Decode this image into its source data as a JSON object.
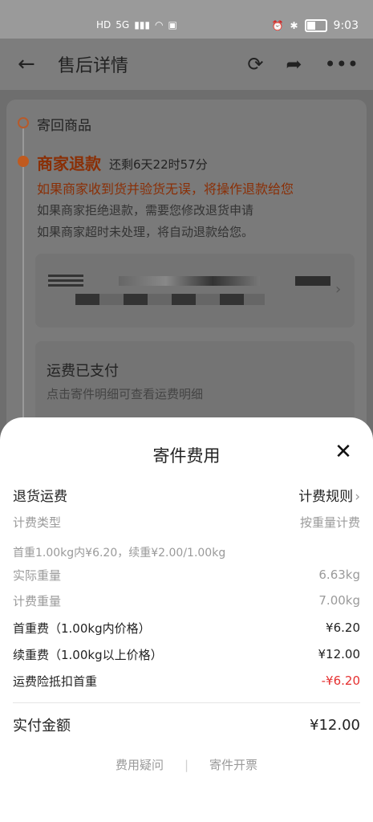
{
  "status_bar": {
    "network": "5G",
    "time": "9:03",
    "battery_level": 0.45
  },
  "nav": {
    "title": "售后详情"
  },
  "background": {
    "step1": "寄回商品",
    "step2_title": "商家退款",
    "step2_remaining": "还剩6天22时57分",
    "step2_note": "如果商家收到货并验货无误，将操作退款给您",
    "step2_line1": "如果商家拒绝退款，需要您修改退货申请",
    "step2_line2": "如果商家超时未处理，将自动退款给您。",
    "paid_title": "运费已支付",
    "paid_desc": "点击寄件明细可查看运费明细"
  },
  "sheet": {
    "title": "寄件费用",
    "return_freight_label": "退货运费",
    "rules_label": "计费规则",
    "billing_type_label": "计费类型",
    "billing_type_value": "按重量计费",
    "price_desc": "首重1.00kg内¥6.20，续重¥2.00/1.00kg",
    "actual_weight_label": "实际重量",
    "actual_weight_value": "6.63kg",
    "billed_weight_label": "计费重量",
    "billed_weight_value": "7.00kg",
    "first_weight_fee_label": "首重费（1.00kg内价格）",
    "first_weight_fee_value": "¥6.20",
    "extra_weight_fee_label": "续重费（1.00kg以上价格）",
    "extra_weight_fee_value": "¥12.00",
    "insurance_label": "运费险抵扣首重",
    "insurance_value": "-¥6.20",
    "total_label": "实付金额",
    "total_value": "¥12.00",
    "footer_left": "费用疑问",
    "footer_sep": "|",
    "footer_right": "寄件开票"
  }
}
